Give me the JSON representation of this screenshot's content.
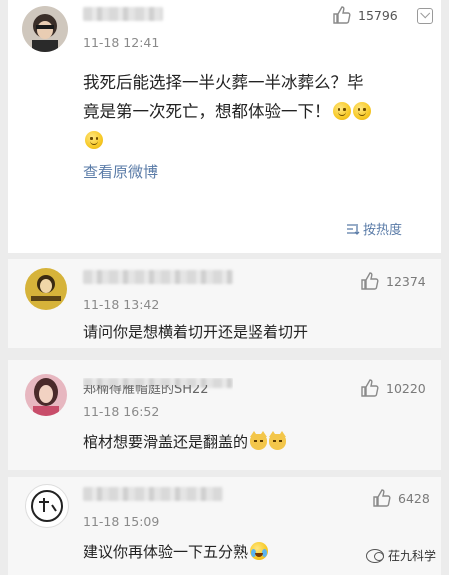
{
  "main": {
    "time": "11-18 12:41",
    "likes": "15796",
    "comment_line1": "我死后能选择一半火葬一半冰葬么？毕",
    "comment_line2": "竟是第一次死亡，想都体验一下！",
    "view_original": "查看原微博",
    "sort_label": "按热度",
    "sort_icon": "sort-icon"
  },
  "replies": [
    {
      "time": "11-18 13:42",
      "likes": "12374",
      "text": "请问你是想横着切开还是竖着切开"
    },
    {
      "username_partial": "郑楠得雁帽庭的SH22",
      "time": "11-18 16:52",
      "likes": "10220",
      "text": "棺材想要滑盖还是翻盖的"
    },
    {
      "time": "11-18 15:09",
      "likes": "6428",
      "text": "建议你再体验一下五分熟"
    }
  ],
  "watermark": {
    "text": "茌九科学"
  },
  "colors": {
    "link": "#5b7ca8",
    "meta": "#8a8a8a",
    "background": "#ececec"
  }
}
